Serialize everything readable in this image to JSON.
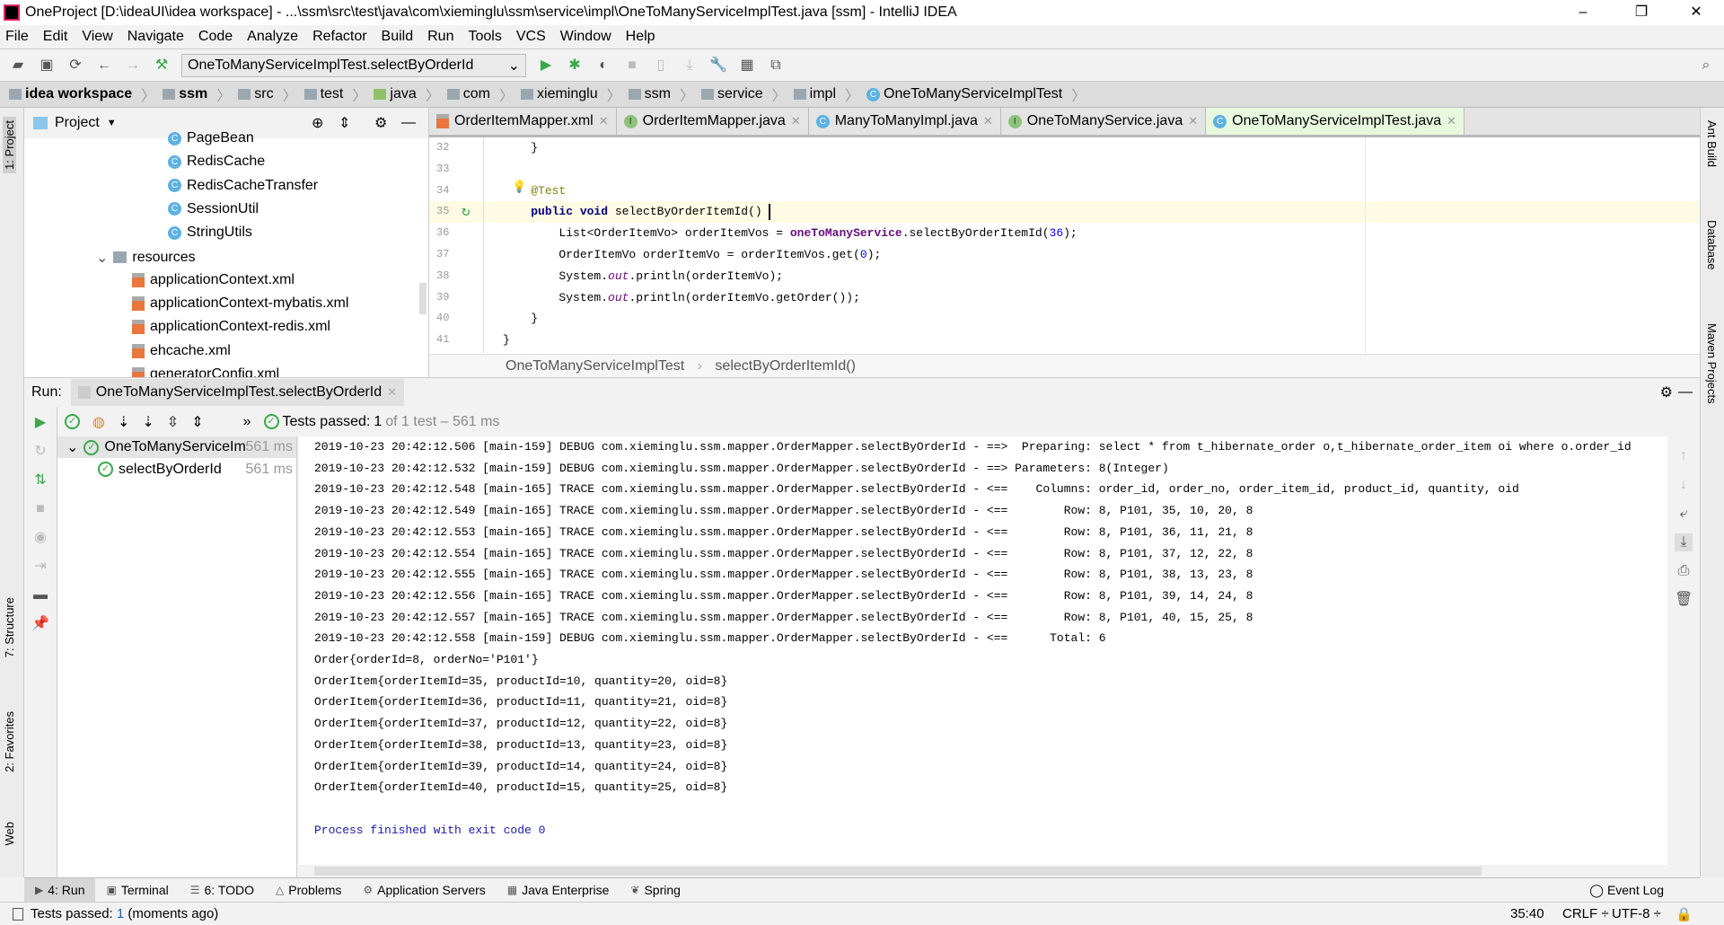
{
  "window": {
    "title": "OneProject [D:\\ideaUI\\idea workspace] - ...\\ssm\\src\\test\\java\\com\\xieminglu\\ssm\\service\\impl\\OneToManyServiceImplTest.java [ssm] - IntelliJ IDEA",
    "minimize": "–",
    "maximize": "❐",
    "close": "✕"
  },
  "menu": [
    "File",
    "Edit",
    "View",
    "Navigate",
    "Code",
    "Analyze",
    "Refactor",
    "Build",
    "Run",
    "Tools",
    "VCS",
    "Window",
    "Help"
  ],
  "toolbar": {
    "run_config": "OneToManyServiceImplTest.selectByOrderId",
    "accent_run": "#3aa84a"
  },
  "breadcrumb": [
    "idea workspace",
    "ssm",
    "src",
    "test",
    "java",
    "com",
    "xieminglu",
    "ssm",
    "service",
    "impl",
    "OneToManyServiceImplTest"
  ],
  "left_strip": {
    "project": "1: Project",
    "structure": "7: Structure",
    "favorites": "2: Favorites",
    "web": "Web"
  },
  "right_strip": {
    "ant": "Ant Build",
    "database": "Database",
    "maven": "Maven Projects"
  },
  "project": {
    "title": "Project",
    "items": [
      {
        "label": "PageBean",
        "type": "class"
      },
      {
        "label": "RedisCache",
        "type": "class"
      },
      {
        "label": "RedisCacheTransfer",
        "type": "class"
      },
      {
        "label": "SessionUtil",
        "type": "class"
      },
      {
        "label": "StringUtils",
        "type": "class"
      },
      {
        "label": "resources",
        "type": "folder"
      },
      {
        "label": "applicationContext.xml",
        "type": "xml"
      },
      {
        "label": "applicationContext-mybatis.xml",
        "type": "xml"
      },
      {
        "label": "applicationContext-redis.xml",
        "type": "xml"
      },
      {
        "label": "ehcache.xml",
        "type": "xml"
      },
      {
        "label": "generatorConfig.xml",
        "type": "xml"
      }
    ]
  },
  "editor": {
    "tabs": [
      {
        "label": "OrderItemMapper.xml",
        "icon": "xml"
      },
      {
        "label": "OrderItemMapper.java",
        "icon": "I"
      },
      {
        "label": "ManyToManyImpl.java",
        "icon": "C"
      },
      {
        "label": "OneToManyService.java",
        "icon": "I"
      },
      {
        "label": "OneToManyServiceImplTest.java",
        "icon": "C",
        "active": true
      }
    ],
    "line_numbers": [
      "32",
      "33",
      "34",
      "35",
      "36",
      "37",
      "38",
      "39",
      "40",
      "41"
    ],
    "lines": [
      [
        {
          "t": "    }"
        }
      ],
      [],
      [
        {
          "t": "    "
        },
        {
          "t": "@Test",
          "c": "ann"
        }
      ],
      [
        {
          "t": "    "
        },
        {
          "t": "public void",
          "c": "kw"
        },
        {
          "t": " selectByOrderItemId() "
        }
      ],
      [
        {
          "t": "        List<OrderItemVo> orderItemVos = "
        },
        {
          "t": "oneToManyService",
          "c": "fld"
        },
        {
          "t": ".selectByOrderItemId("
        },
        {
          "t": "36",
          "c": "num"
        },
        {
          "t": ");"
        }
      ],
      [
        {
          "t": "        OrderItemVo orderItemVo = orderItemVos.get("
        },
        {
          "t": "0",
          "c": "num"
        },
        {
          "t": ");"
        }
      ],
      [
        {
          "t": "        System."
        },
        {
          "t": "out",
          "c": "st"
        },
        {
          "t": ".println(orderItemVo);"
        }
      ],
      [
        {
          "t": "        System."
        },
        {
          "t": "out",
          "c": "st"
        },
        {
          "t": ".println(orderItemVo.getOrder());"
        }
      ],
      [
        {
          "t": "    }"
        }
      ],
      [
        {
          "t": "}"
        }
      ]
    ],
    "crumb_class": "OneToManyServiceImplTest",
    "crumb_sep": "›",
    "crumb_method": "selectByOrderItemId()"
  },
  "run": {
    "label": "Run:",
    "tab": "OneToManyServiceImplTest.selectByOrderId",
    "status_prefix": "Tests passed:",
    "status_count": "1",
    "status_rest": "of 1 test – 561 ms",
    "tree": [
      {
        "label": "OneToManyServiceIm",
        "time": "561 ms"
      },
      {
        "label": "selectByOrderId",
        "time": "561 ms"
      }
    ],
    "console": [
      "2019-10-23 20:42:12.506 [main-159] DEBUG com.xieminglu.ssm.mapper.OrderMapper.selectByOrderId - ==>  Preparing: select * from t_hibernate_order o,t_hibernate_order_item oi where o.order_id",
      "2019-10-23 20:42:12.532 [main-159] DEBUG com.xieminglu.ssm.mapper.OrderMapper.selectByOrderId - ==> Parameters: 8(Integer)",
      "2019-10-23 20:42:12.548 [main-165] TRACE com.xieminglu.ssm.mapper.OrderMapper.selectByOrderId - <==    Columns: order_id, order_no, order_item_id, product_id, quantity, oid",
      "2019-10-23 20:42:12.549 [main-165] TRACE com.xieminglu.ssm.mapper.OrderMapper.selectByOrderId - <==        Row: 8, P101, 35, 10, 20, 8",
      "2019-10-23 20:42:12.553 [main-165] TRACE com.xieminglu.ssm.mapper.OrderMapper.selectByOrderId - <==        Row: 8, P101, 36, 11, 21, 8",
      "2019-10-23 20:42:12.554 [main-165] TRACE com.xieminglu.ssm.mapper.OrderMapper.selectByOrderId - <==        Row: 8, P101, 37, 12, 22, 8",
      "2019-10-23 20:42:12.555 [main-165] TRACE com.xieminglu.ssm.mapper.OrderMapper.selectByOrderId - <==        Row: 8, P101, 38, 13, 23, 8",
      "2019-10-23 20:42:12.556 [main-165] TRACE com.xieminglu.ssm.mapper.OrderMapper.selectByOrderId - <==        Row: 8, P101, 39, 14, 24, 8",
      "2019-10-23 20:42:12.557 [main-165] TRACE com.xieminglu.ssm.mapper.OrderMapper.selectByOrderId - <==        Row: 8, P101, 40, 15, 25, 8",
      "2019-10-23 20:42:12.558 [main-159] DEBUG com.xieminglu.ssm.mapper.OrderMapper.selectByOrderId - <==      Total: 6",
      "Order{orderId=8, orderNo='P101'}",
      "OrderItem{orderItemId=35, productId=10, quantity=20, oid=8}",
      "OrderItem{orderItemId=36, productId=11, quantity=21, oid=8}",
      "OrderItem{orderItemId=37, productId=12, quantity=22, oid=8}",
      "OrderItem{orderItemId=38, productId=13, quantity=23, oid=8}",
      "OrderItem{orderItemId=39, productId=14, quantity=24, oid=8}",
      "OrderItem{orderItemId=40, productId=15, quantity=25, oid=8}",
      "",
      "Process finished with exit code 0"
    ]
  },
  "bottom_tabs": [
    "4: Run",
    "Terminal",
    "6: TODO",
    "Problems",
    "Application Servers",
    "Java Enterprise",
    "Spring"
  ],
  "event_log": "Event Log",
  "status": {
    "text_prefix": "Tests passed:",
    "count": "1",
    "text_rest": "(moments ago)",
    "position": "35:40",
    "line_sep": "CRLF ÷",
    "encoding": "UTF-8 ÷"
  }
}
